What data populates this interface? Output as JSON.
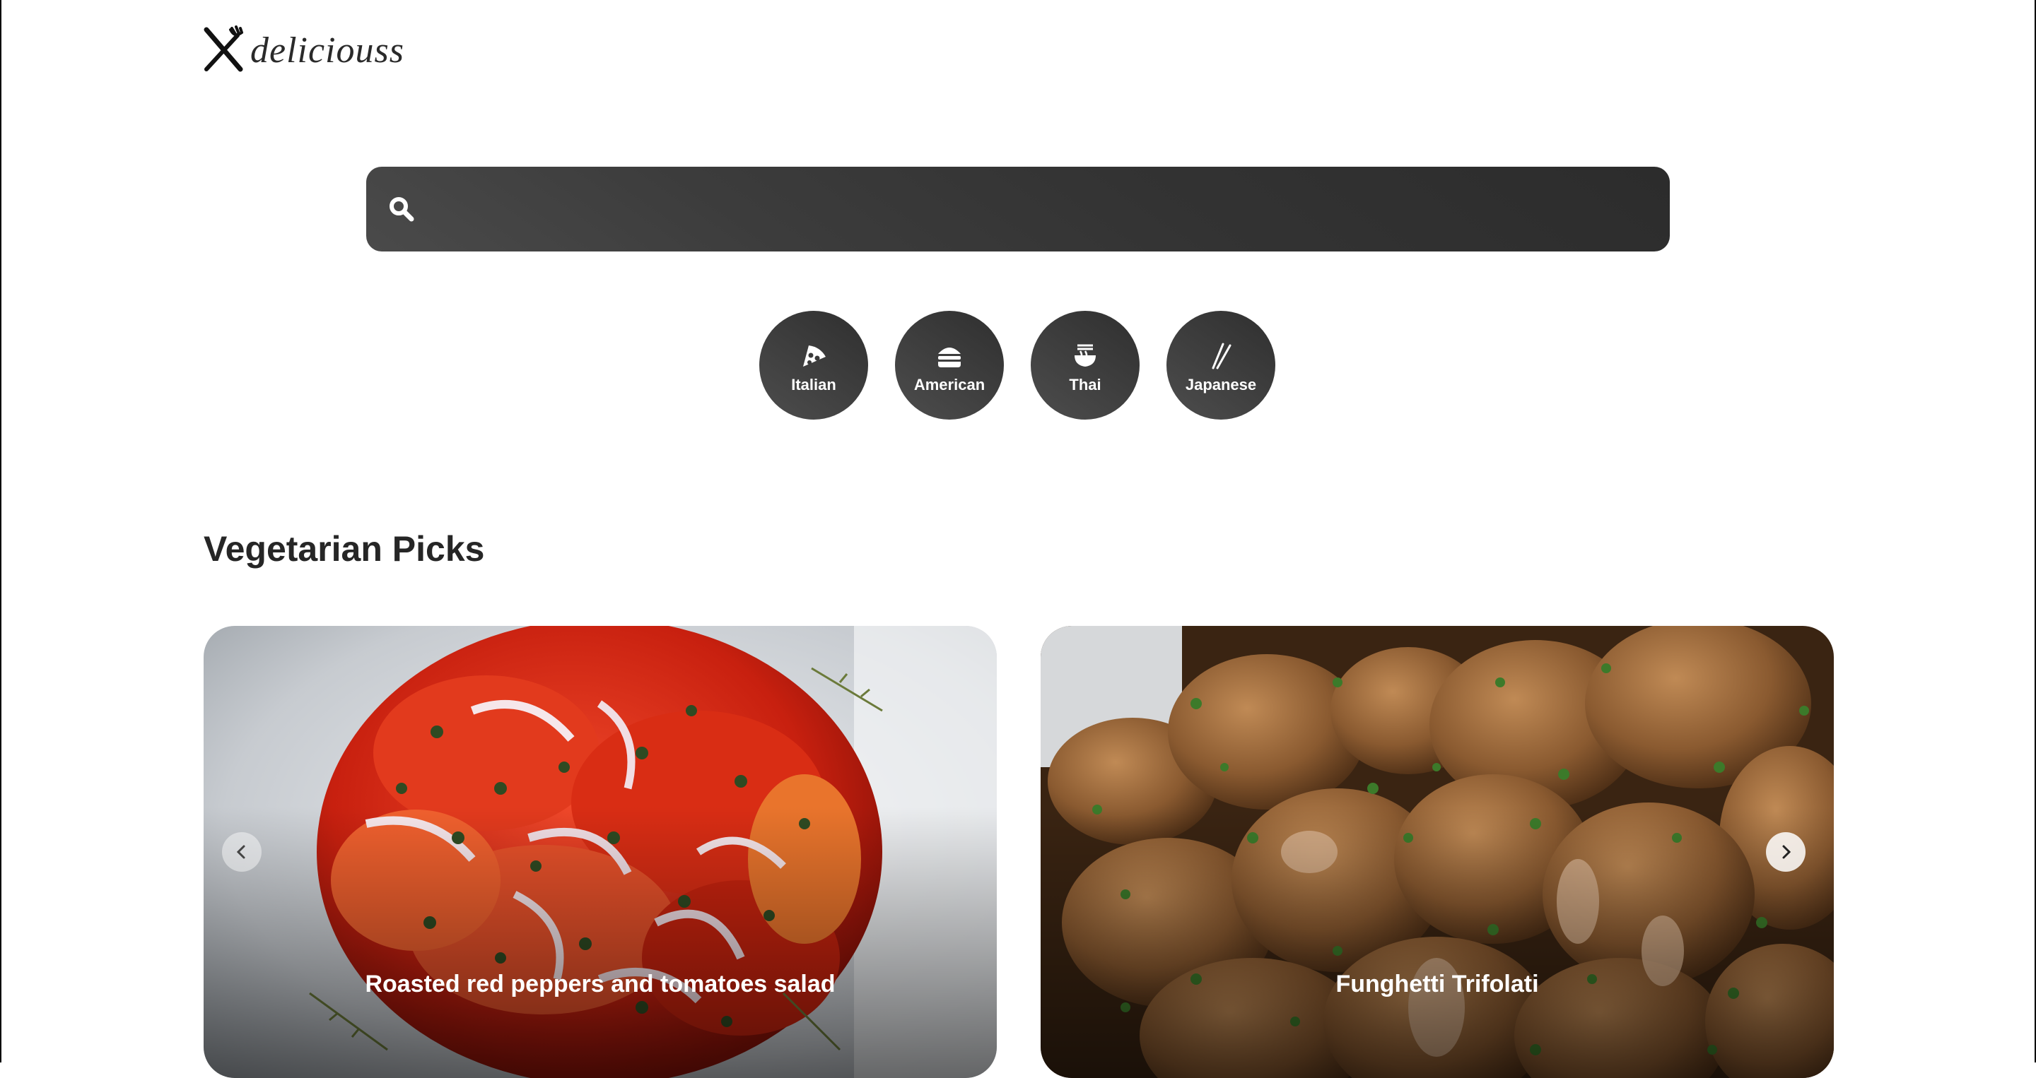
{
  "brand": {
    "name": "deliciouss",
    "icon": "fork-knife-icon"
  },
  "search": {
    "placeholder": "",
    "value": "",
    "icon": "search-icon"
  },
  "cuisines": [
    {
      "label": "Italian",
      "icon": "pizza-icon"
    },
    {
      "label": "American",
      "icon": "burger-icon"
    },
    {
      "label": "Thai",
      "icon": "noodle-bowl-icon"
    },
    {
      "label": "Japanese",
      "icon": "chopsticks-icon"
    }
  ],
  "section": {
    "title": "Vegetarian Picks"
  },
  "recipes": [
    {
      "title": "Roasted red peppers and tomatoes salad"
    },
    {
      "title": "Funghetti Trifolati"
    }
  ],
  "colors": {
    "accent_dark": "#313131",
    "background": "#ffffff"
  }
}
